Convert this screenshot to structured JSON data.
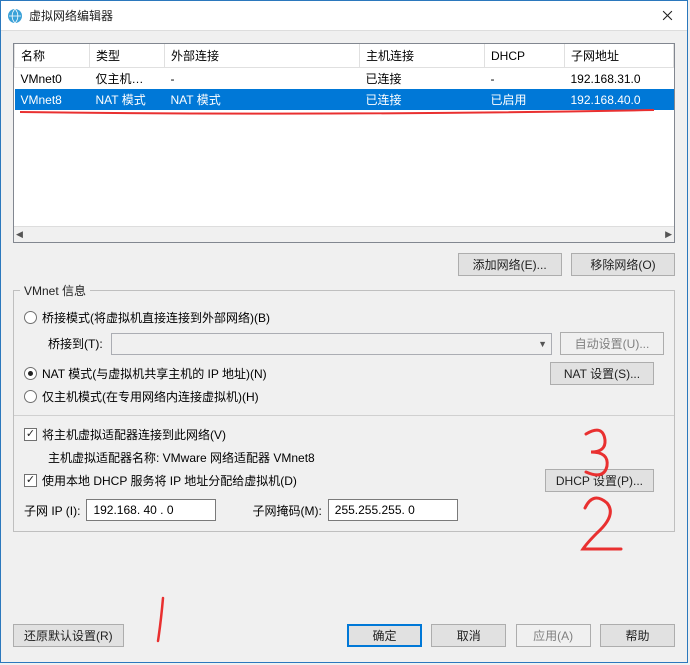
{
  "titlebar": {
    "title": "虚拟网络编辑器"
  },
  "table": {
    "headers": [
      "名称",
      "类型",
      "外部连接",
      "主机连接",
      "DHCP",
      "子网地址"
    ],
    "rows": [
      [
        "VMnet0",
        "仅主机…",
        "-",
        "已连接",
        "-",
        "192.168.31.0"
      ],
      [
        "VMnet8",
        "NAT 模式",
        "NAT 模式",
        "已连接",
        "已启用",
        "192.168.40.0"
      ]
    ]
  },
  "buttons": {
    "add_net": "添加网络(E)...",
    "remove_net": "移除网络(O)",
    "auto_set": "自动设置(U)...",
    "nat_set": "NAT 设置(S)...",
    "dhcp_set": "DHCP 设置(P)...",
    "restore": "还原默认设置(R)",
    "ok": "确定",
    "cancel": "取消",
    "apply": "应用(A)",
    "help": "帮助"
  },
  "groupbox": {
    "legend": "VMnet 信息",
    "opt_bridge": "桥接模式(将虚拟机直接连接到外部网络)(B)",
    "bridge_to": "桥接到(T):",
    "opt_nat": "NAT 模式(与虚拟机共享主机的 IP 地址)(N)",
    "opt_hostonly": "仅主机模式(在专用网络内连接虚拟机)(H)",
    "chk_connect": "将主机虚拟适配器连接到此网络(V)",
    "adapter_label": "主机虚拟适配器名称: VMware 网络适配器 VMnet8",
    "chk_dhcp": "使用本地 DHCP 服务将 IP 地址分配给虚拟机(D)",
    "subnet_ip_label": "子网 IP (I):",
    "subnet_ip": "192.168. 40 . 0",
    "mask_label": "子网掩码(M):",
    "mask": "255.255.255. 0"
  },
  "annotations": {
    "num3": "3",
    "num2": "2",
    "num1": "1"
  }
}
